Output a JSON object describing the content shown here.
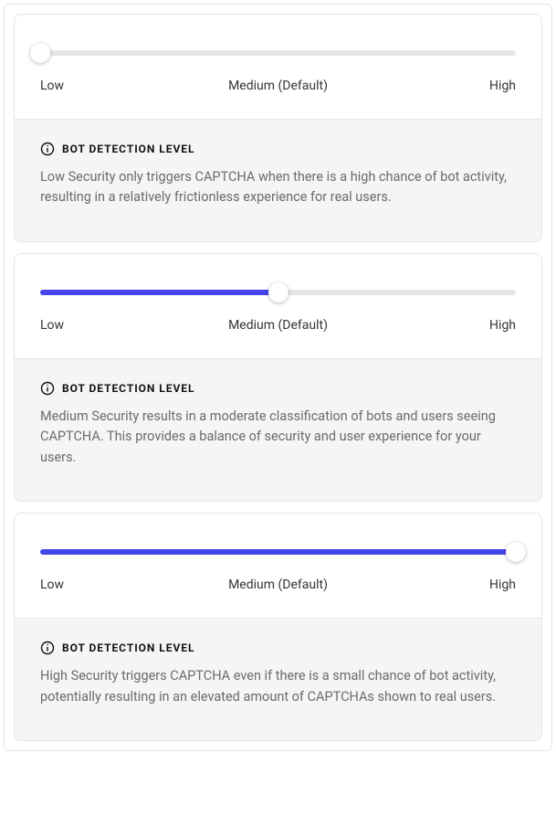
{
  "labels": {
    "low": "Low",
    "medium": "Medium (Default)",
    "high": "High"
  },
  "info_title": "BOT DETECTION LEVEL",
  "cards": [
    {
      "fill_pct": 0,
      "thumb_pct": 0,
      "desc": "Low Security only triggers CAPTCHA when there is a high chance of bot activity, resulting in a relatively frictionless experience for real users."
    },
    {
      "fill_pct": 50,
      "thumb_pct": 50,
      "desc": "Medium Security results in a moderate classification of bots and users seeing CAPTCHA. This provides a balance of security and user experience for your users."
    },
    {
      "fill_pct": 100,
      "thumb_pct": 100,
      "desc": "High Security triggers CAPTCHA even if there is a small chance of bot activity, potentially resulting in an elevated amount of CAPTCHAs shown to real users."
    }
  ]
}
